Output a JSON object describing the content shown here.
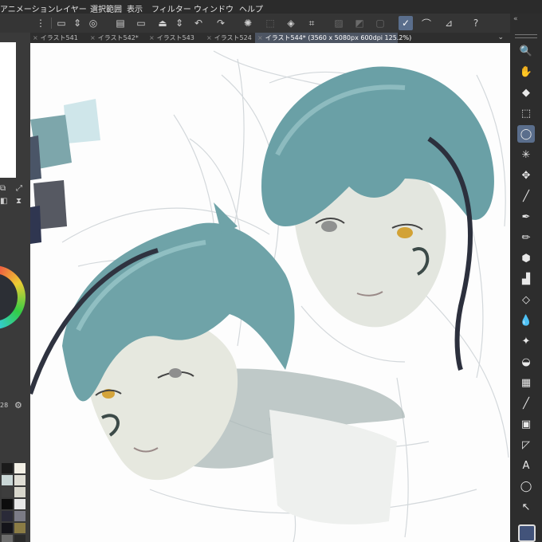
{
  "menu": {
    "items": [
      "アニメーション",
      "レイヤー",
      "選択範囲",
      "表示",
      "フィルター",
      "ウィンドウ",
      "ヘルプ"
    ]
  },
  "command_bar": {
    "icons": [
      "new-icon",
      "updown-icon",
      "swirl-icon",
      "open-icon",
      "save-icon",
      "updown-icon",
      "undo-icon",
      "redo-icon",
      "loading-icon",
      "transform-icon",
      "fill-icon",
      "crop-icon",
      "layer-off-icon",
      "layer-mask-icon",
      "layer-half-icon",
      "draw-icon",
      "brush-icon",
      "ruler-icon",
      "help-icon"
    ]
  },
  "tabs": [
    {
      "label": "イラスト541",
      "active": false
    },
    {
      "label": "イラスト542*",
      "active": false
    },
    {
      "label": "イラスト543",
      "active": false
    },
    {
      "label": "イラスト524",
      "active": false
    },
    {
      "label": "イラスト544* (3560 x 5080px 600dpi 125.2%)",
      "active": true
    }
  ],
  "left_panel": {
    "zoom_value": "28",
    "swatches": [
      [
        "#1b1b1b",
        "#f3f0e6"
      ],
      [
        "#c9d6d5",
        "#e0ded5"
      ],
      [
        "#3d3d3d",
        "#d8d6cc"
      ],
      [
        "#0d0d0d",
        "#e8e8e8"
      ],
      [
        "#2a2a38",
        "#7b7b86"
      ],
      [
        "#14141a",
        "#8a7b45"
      ],
      [
        "#6d6d6d",
        "#2a2a2a"
      ],
      [
        "#9a9a9a",
        "#454545"
      ]
    ]
  },
  "canvas": {
    "palette_swatches": [
      "#cfe5e8",
      "#7ea8ad",
      "#4a5567",
      "#5a5d66",
      "#2f3650"
    ]
  },
  "right_toolbar": {
    "tools": [
      {
        "name": "zoom-icon",
        "glyph": "🔍",
        "active": false
      },
      {
        "name": "hand-icon",
        "glyph": "✋",
        "active": false
      },
      {
        "name": "eraser-icon",
        "glyph": "◆",
        "active": false
      },
      {
        "name": "operation-icon",
        "glyph": "⬚",
        "active": false
      },
      {
        "name": "lasso-icon",
        "glyph": "◯",
        "active": true
      },
      {
        "name": "magic-wand-icon",
        "glyph": "✳",
        "active": false
      },
      {
        "name": "move-icon",
        "glyph": "✥",
        "active": false
      },
      {
        "name": "eyedropper-icon",
        "glyph": "╱",
        "active": false
      },
      {
        "name": "pen-icon",
        "glyph": "✒",
        "active": false
      },
      {
        "name": "pencil-icon",
        "glyph": "✏",
        "active": false
      },
      {
        "name": "brush-icon",
        "glyph": "⬢",
        "active": false
      },
      {
        "name": "airbrush-icon",
        "glyph": "▟",
        "active": false
      },
      {
        "name": "soft-eraser-icon",
        "glyph": "◇",
        "active": false
      },
      {
        "name": "blend-icon",
        "glyph": "💧",
        "active": false
      },
      {
        "name": "decoration-icon",
        "glyph": "✦",
        "active": false
      },
      {
        "name": "fill-bucket-icon",
        "glyph": "◒",
        "active": false
      },
      {
        "name": "gradient-icon",
        "glyph": "▦",
        "active": false
      },
      {
        "name": "line-icon",
        "glyph": "╱",
        "active": false
      },
      {
        "name": "frame-icon",
        "glyph": "▣",
        "active": false
      },
      {
        "name": "ruler-icon",
        "glyph": "◸",
        "active": false
      },
      {
        "name": "text-icon",
        "glyph": "A",
        "active": false
      },
      {
        "name": "balloon-icon",
        "glyph": "◯",
        "active": false
      },
      {
        "name": "correction-icon",
        "glyph": "↖",
        "active": false
      }
    ],
    "current_color": "#42537a"
  }
}
